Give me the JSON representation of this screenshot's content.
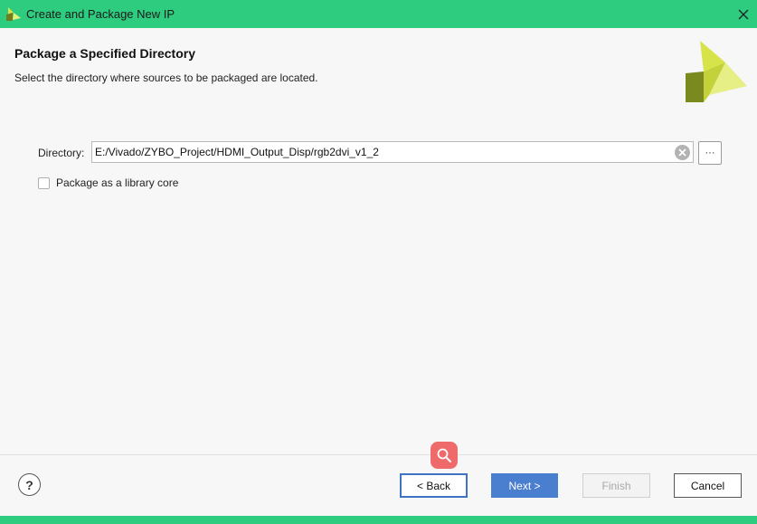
{
  "window": {
    "title": "Create and Package New IP",
    "accent_color": "#2ecc7f"
  },
  "header": {
    "title": "Package a Specified Directory",
    "subtitle": "Select the directory where sources to be packaged are located."
  },
  "directory": {
    "label": "Directory:",
    "value": "E:/Vivado/ZYBO_Project/HDMI_Output_Disp/rgb2dvi_v1_2",
    "browse_label": "···"
  },
  "library_core": {
    "label": "Package as a library core",
    "checked": false
  },
  "footer": {
    "help_label": "?",
    "back_label": "< Back",
    "next_label": "Next >",
    "finish_label": "Finish",
    "cancel_label": "Cancel"
  },
  "icons": {
    "app": "vivado-logo-icon",
    "close": "close-icon",
    "clear": "clear-icon",
    "zoom": "magnifier-icon"
  }
}
